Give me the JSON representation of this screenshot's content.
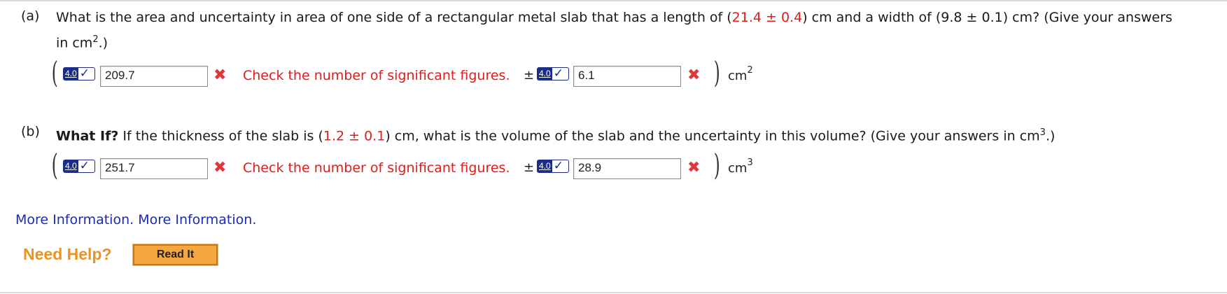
{
  "part_a": {
    "label": "(a)",
    "text_1": "What is the area and uncertainty in area of one side of a rectangular metal slab that has a length of (",
    "length_value": "21.4 ± 0.4",
    "text_2": ") cm and a width of (9.8 ± 0.1) cm? (Give your answers",
    "line2_prefix": "in cm",
    "line2_sup": "2",
    "line2_suffix": ".)",
    "version_badge": "4.0",
    "value_answer": "209.7",
    "feedback": "Check the number of significant figures.",
    "pm": "±",
    "uncertainty_answer": "6.1",
    "unit_base": "cm",
    "unit_sup": "2"
  },
  "part_b": {
    "label": "(b)",
    "bold_lead": "What If?",
    "text_1": " If the thickness of the slab is (",
    "thickness_value": "1.2 ± 0.1",
    "text_2": ") cm, what is the volume of the slab and the uncertainty in this volume? (Give your answers in cm",
    "text_sup": "3",
    "text_3": ".)",
    "version_badge": "4.0",
    "value_answer": "251.7",
    "feedback": "Check the number of significant figures.",
    "pm": "±",
    "uncertainty_answer": "28.9",
    "unit_base": "cm",
    "unit_sup": "3"
  },
  "more_info": "More Information. More Information.",
  "need_help": "Need Help?",
  "read_it": "Read It",
  "colors": {
    "feedback_red": "#e21b1b",
    "badge_blue": "#1b2d86",
    "help_orange": "#f0911e",
    "link_blue": "#1a2ab8"
  }
}
